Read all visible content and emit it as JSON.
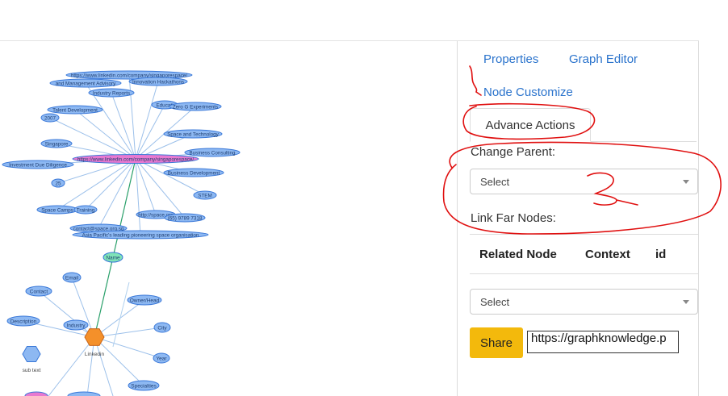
{
  "graph": {
    "upper_nodes": [
      "https://www.linkedin.com/company/singaporespace/",
      "and Management Advisory",
      "Innovation Hackathons",
      "Industry Reports",
      "Talent Development",
      "Educati",
      "Zero G Experiments",
      "2007",
      "Space and Technology",
      "Singapore",
      "Business Consulting",
      "Investment Due Diligence",
      "Business Development",
      "25",
      "STEM",
      "Space Camps",
      "Training",
      "http://space.org",
      "(65) 9789 7318",
      "contact@space.org.sg",
      "Asia Pacific's leading pioneering space organisation"
    ],
    "center_node": "https://www.linkedin.com/company/singaporespace/",
    "name_node": "Name",
    "lower_nodes": [
      "Email",
      "Contact",
      "Owner/Head",
      "Description",
      "Industry",
      "City",
      "Year",
      "Specialties"
    ],
    "hub_label": "Linkedin",
    "legend_label": "sub text"
  },
  "panel": {
    "tabs": [
      "Properties",
      "Graph Editor",
      "Node Customize"
    ],
    "active_tab": "Advance Actions",
    "change_parent_label": "Change Parent:",
    "change_parent_select": "Select",
    "link_far_label": "Link Far Nodes:",
    "table_headers": [
      "Related Node",
      "Context",
      "id"
    ],
    "link_select": "Select",
    "share_label": "Share",
    "share_url": "https://graphknowledge.p"
  },
  "annotations": {
    "tab_marker": "1",
    "dropdown_marker": "2"
  },
  "colors": {
    "node_fill": "#8db8f2",
    "node_stroke": "#3a78d8",
    "center_fill": "#e879d0",
    "name_fill": "#7fe3b8",
    "hub_fill": "#f4902a",
    "share": "#f3b90c",
    "link": "#2a73cc",
    "annotation": "#e01010"
  }
}
